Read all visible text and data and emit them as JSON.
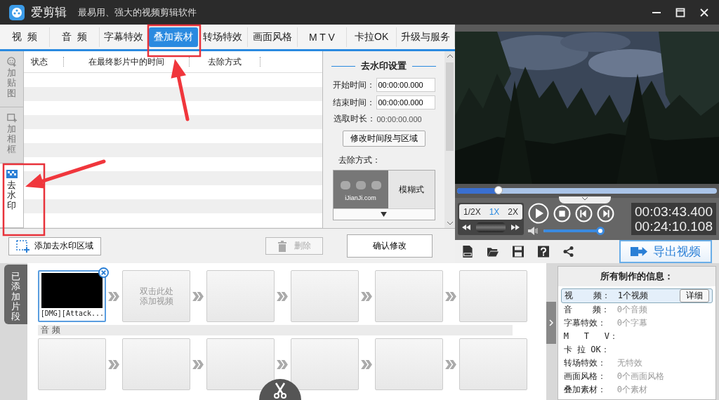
{
  "app": {
    "name": "爱剪辑",
    "slogan": "最易用、强大的视频剪辑软件"
  },
  "tabs": [
    {
      "label": "视  频",
      "selected": false
    },
    {
      "label": "音  频",
      "selected": false
    },
    {
      "label": "字幕特效",
      "selected": false
    },
    {
      "label": "叠加素材",
      "selected": true
    },
    {
      "label": "转场特效",
      "selected": false
    },
    {
      "label": "画面风格",
      "selected": false
    },
    {
      "label": "M T V",
      "selected": false
    },
    {
      "label": "卡拉OK",
      "selected": false
    },
    {
      "label": "升级与服务",
      "selected": false
    }
  ],
  "side_tabs": [
    {
      "label": "加贴图",
      "kind": "sticker",
      "selected": false
    },
    {
      "label": "加相框",
      "kind": "frame",
      "selected": false
    },
    {
      "label": "去水印",
      "kind": "watermark",
      "selected": true
    }
  ],
  "table": {
    "columns": [
      "状态",
      "在最终影片中的时间",
      "去除方式"
    ]
  },
  "add_button": "添加去水印区域",
  "delete_button": {
    "label": "删除",
    "disabled": true
  },
  "settings": {
    "title": "去水印设置",
    "fields": [
      {
        "label": "开始时间：",
        "value": "00:00:00.000",
        "kind": "input"
      },
      {
        "label": "结束时间：",
        "value": "00:00:00.000",
        "kind": "input"
      },
      {
        "label": "选取时长：",
        "value": "00:00:00.000",
        "kind": "text"
      }
    ],
    "modify_button": "修改时间段与区域",
    "method_label": "去除方式：",
    "sample_text": "iJianJi.com",
    "method_name": "模糊式",
    "confirm_button": "确认修改"
  },
  "player": {
    "progress": {
      "level": 0.16
    },
    "speeds": [
      {
        "label": "1/2X",
        "selected": false
      },
      {
        "label": "1X",
        "selected": true
      },
      {
        "label": "2X",
        "selected": false
      }
    ],
    "volume": {
      "level": 0.97
    },
    "current_time": "00:03:43.400",
    "total_time": "00:24:10.108",
    "export_button": "导出视频"
  },
  "timeline": {
    "label": "已添加片段",
    "clips": [
      {
        "kind": "video",
        "title": "[DMG][Attack..."
      },
      {
        "kind": "hint",
        "lines": [
          "双击此处",
          "添加视频"
        ]
      },
      {
        "kind": "empty"
      },
      {
        "kind": "empty"
      },
      {
        "kind": "empty"
      },
      {
        "kind": "empty"
      }
    ],
    "audio_label": "音 频",
    "audio_clips": [
      {
        "kind": "empty"
      },
      {
        "kind": "empty"
      },
      {
        "kind": "empty"
      },
      {
        "kind": "empty"
      },
      {
        "kind": "empty"
      },
      {
        "kind": "empty"
      }
    ]
  },
  "info": {
    "title": "所有制作的信息：",
    "detail_button": "详细",
    "rows": [
      {
        "label": "视    频：",
        "value": "1个视频",
        "selected": true
      },
      {
        "label": "音    频：",
        "value": "0个音频",
        "selected": false
      },
      {
        "label": "字幕特效：",
        "value": "0个字幕",
        "selected": false
      },
      {
        "label": "M   T   V：",
        "selected": false
      },
      {
        "label": "卡 拉 OK：",
        "selected": false
      },
      {
        "label": "转场特效：",
        "value": "无特效",
        "selected": false
      },
      {
        "label": "画面风格：",
        "value": "0个画面风格",
        "selected": false
      },
      {
        "label": "叠加素材：",
        "value": "0个素材",
        "selected": false
      }
    ]
  },
  "annotations": [
    {
      "kind": "frame"
    },
    {
      "kind": "arrow"
    },
    {
      "kind": "frame"
    },
    {
      "kind": "arrow"
    }
  ]
}
